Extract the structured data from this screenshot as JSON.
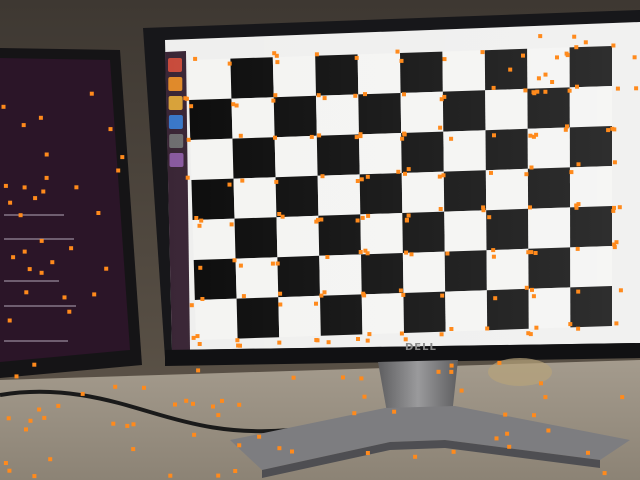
{
  "scene": {
    "description_free": true,
    "brand_label": "DELL",
    "board": {
      "rows": 7,
      "cols": 10
    },
    "launcher": {
      "icon_count": 6
    },
    "palette": {
      "wall": "#4a423a",
      "desk": "#9c9384",
      "monitor_bezel": "#1a1a1c",
      "board_dark": "#0c0c0c",
      "board_light": "#f4f4f2",
      "left_screen": "#2a1426",
      "marker": "#ff8a1c"
    }
  }
}
